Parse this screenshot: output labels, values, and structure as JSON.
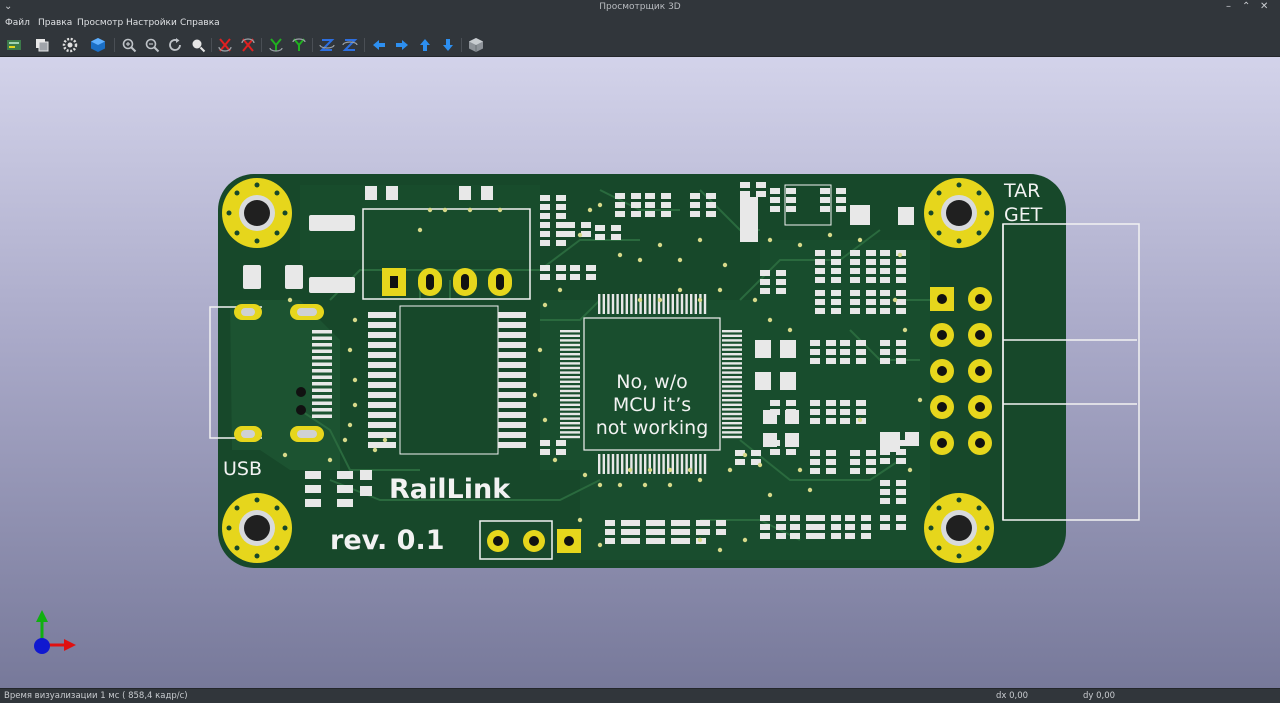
{
  "window": {
    "title": "Просмотрщик 3D",
    "controls": [
      "⌄",
      "–",
      "⌃",
      "✕"
    ]
  },
  "menu": [
    "Файл",
    "Правка",
    "Просмотр",
    "Настройки",
    "Справка"
  ],
  "toolbar": {
    "icons": [
      "render-options-icon",
      "copy-image-icon",
      "preferences-icon",
      "raytracing-icon",
      "zoom-in-icon",
      "zoom-out-icon",
      "redraw-icon",
      "zoom-fit-icon",
      "rotate-x-cw-icon",
      "rotate-x-ccw-icon",
      "rotate-y-cw-icon",
      "rotate-y-ccw-icon",
      "rotate-z-cw-icon",
      "rotate-z-ccw-icon",
      "pan-left-icon",
      "pan-right-icon",
      "pan-up-icon",
      "pan-down-icon",
      "ortho-icon"
    ]
  },
  "board": {
    "usb_label": "USB",
    "target_label_line1": "TAR",
    "target_label_line2": "GET",
    "note_line1": "No, w/o",
    "note_line2": "MCU it’s",
    "note_line3": "not working",
    "name": "RailLink",
    "revision": "rev. 0.1",
    "colors": {
      "soldermask": "#17482a",
      "silkscreen": "#f2f2f2",
      "pad_gold": "#e6d61c",
      "background_top": "#d3d3ea",
      "background_bottom": "#77799a"
    }
  },
  "axes": {
    "x_color": "#e01010",
    "y_color": "#10b010",
    "z_color": "#1018d0"
  },
  "status": {
    "render_time": "Время визуализации 1 мс ( 858,4 кадр/с)",
    "dx": "dx 0,00",
    "dy": "dy 0,00"
  }
}
